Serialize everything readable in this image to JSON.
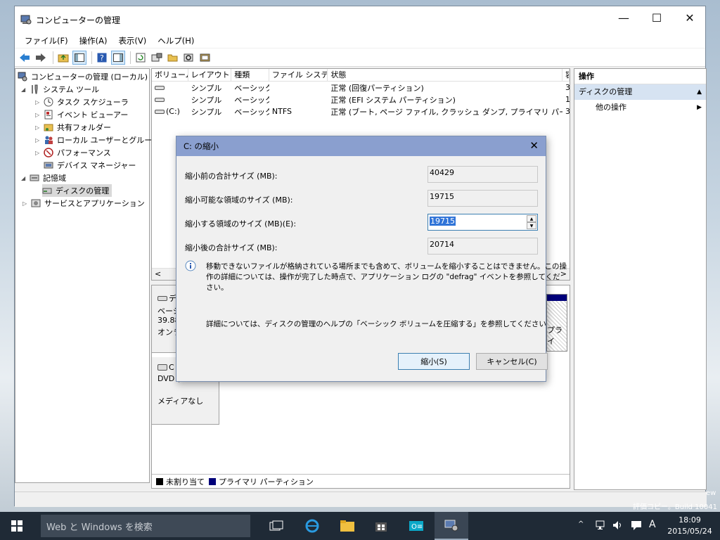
{
  "window": {
    "title": "コンピューターの管理",
    "controls": {
      "minimize": "—",
      "maximize": "☐",
      "close": "✕"
    }
  },
  "menu": {
    "items": [
      "ファイル(F)",
      "操作(A)",
      "表示(V)",
      "ヘルプ(H)"
    ]
  },
  "tree": {
    "root": "コンピューターの管理 (ローカル)",
    "system_tools": "システム ツール",
    "task_scheduler": "タスク スケジューラ",
    "event_viewer": "イベント ビューアー",
    "shared_folders": "共有フォルダー",
    "local_users": "ローカル ユーザーとグループ",
    "performance": "パフォーマンス",
    "device_manager": "デバイス マネージャー",
    "storage": "記憶域",
    "disk_management": "ディスクの管理",
    "services_apps": "サービスとアプリケーション"
  },
  "volumes": {
    "headers": [
      "ボリューム",
      "レイアウト",
      "種類",
      "ファイル システム",
      "状態",
      "容"
    ],
    "rows": [
      {
        "volume": "",
        "layout": "シンプル",
        "type": "ベーシック",
        "fs": "",
        "status": "正常 (回復パーティション)",
        "cap": "3"
      },
      {
        "volume": "",
        "layout": "シンプル",
        "type": "ベーシック",
        "fs": "",
        "status": "正常 (EFI システム パーティション)",
        "cap": "1"
      },
      {
        "volume": "(C:)",
        "layout": "シンプル",
        "type": "ベーシック",
        "fs": "NTFS",
        "status": "正常 (ブート, ページ ファイル, クラッシュ ダンプ, プライマリ パーティション)",
        "cap": "3"
      }
    ]
  },
  "disks": {
    "disk0_name": "デ",
    "disk0_type": "ベーシ",
    "disk0_size": "39.88",
    "disk0_state": "オンラ",
    "partition_fragment": "プライ",
    "cd_name": "C",
    "cd_type": "DVD (",
    "cd_media": "メディアなし"
  },
  "legend": {
    "unallocated": "未割り当て",
    "primary": "プライマリ パーティション",
    "unallocated_color": "#000000",
    "primary_color": "#00007a"
  },
  "actions_pane": {
    "header": "操作",
    "section": "ディスクの管理",
    "other": "他の操作"
  },
  "dialog": {
    "title": "C: の縮小",
    "total_before_label": "縮小前の合計サイズ (MB):",
    "total_before_value": "40429",
    "available_label": "縮小可能な領域のサイズ (MB):",
    "available_value": "19715",
    "shrink_label": "縮小する領域のサイズ (MB)(E):",
    "shrink_value": "19715",
    "total_after_label": "縮小後の合計サイズ (MB):",
    "total_after_value": "20714",
    "info_line1": "移動できないファイルが格納されている場所までも含めて、ボリュームを縮小することはできません。この操",
    "info_line2": "作の詳細については、操作が完了した時点で、アプリケーション ログの \"defrag\" イベントを参照してくだ",
    "info_line3": "さい。",
    "help_text": "詳細については、ディスクの管理のヘルプの「ベーシック ボリュームを圧縮する」を参照してください",
    "shrink_button": "縮小(S)",
    "cancel_button": "キャンセル(C)"
  },
  "desktop_watermark": {
    "line1": "ew",
    "line2": "評価コピー。Build 10041"
  },
  "taskbar": {
    "search_placeholder": "Web と Windows を検索",
    "time": "18:09",
    "date": "2015/05/24",
    "ime": "A",
    "accent": "#1f2a36"
  }
}
